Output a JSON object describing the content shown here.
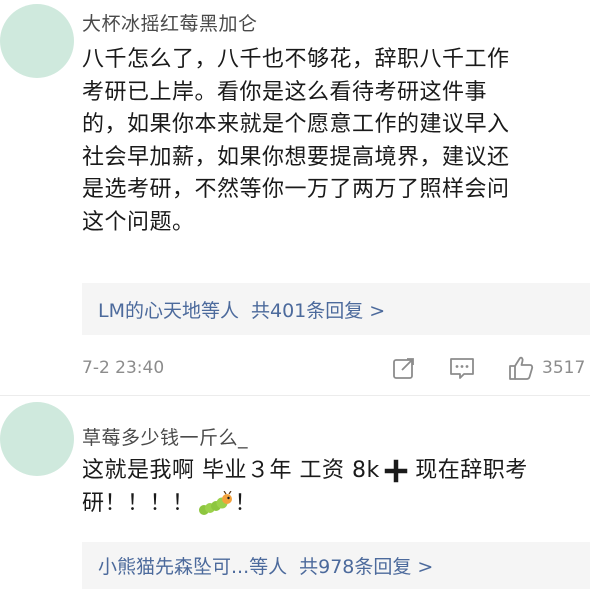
{
  "comments": [
    {
      "username": "大杯冰摇红莓黑加仑",
      "lines": [
        "八千怎么了，八千也不够花，辞职八千工作",
        "考研已上岸。看你是这么看待考研这件事",
        "的，如果你本来就是个愿意工作的建议早入",
        "社会早加薪，如果你想要提高境界，建议还",
        "是选考研，不然等你一万了两万了照样会问",
        "这个问题。"
      ],
      "reply_users": "LM的心天地等人",
      "reply_count": "共401条回复 >",
      "timestamp": "7-2 23:40",
      "like_count": "3517"
    },
    {
      "username": "草莓多少钱一斤么_",
      "line1_a": "这就是我啊 毕业３年 工资 8k",
      "line1_b": " 现在辞职考",
      "line2": "研！！！！",
      "line2_tail": "！",
      "reply_users": "小熊猫先森坠可...等人",
      "reply_count": "共978条回复 >"
    }
  ],
  "icons": {
    "share": "share-icon",
    "comment": "comment-icon",
    "like": "thumbs-up-icon",
    "plus": "heavy-plus-icon",
    "emoji": "caterpillar-emoji"
  },
  "colors": {
    "avatar": "#cfe9dd",
    "link": "#4c6a9c",
    "reply_bg": "#f5f5f5",
    "meta": "#8c8c8c"
  }
}
